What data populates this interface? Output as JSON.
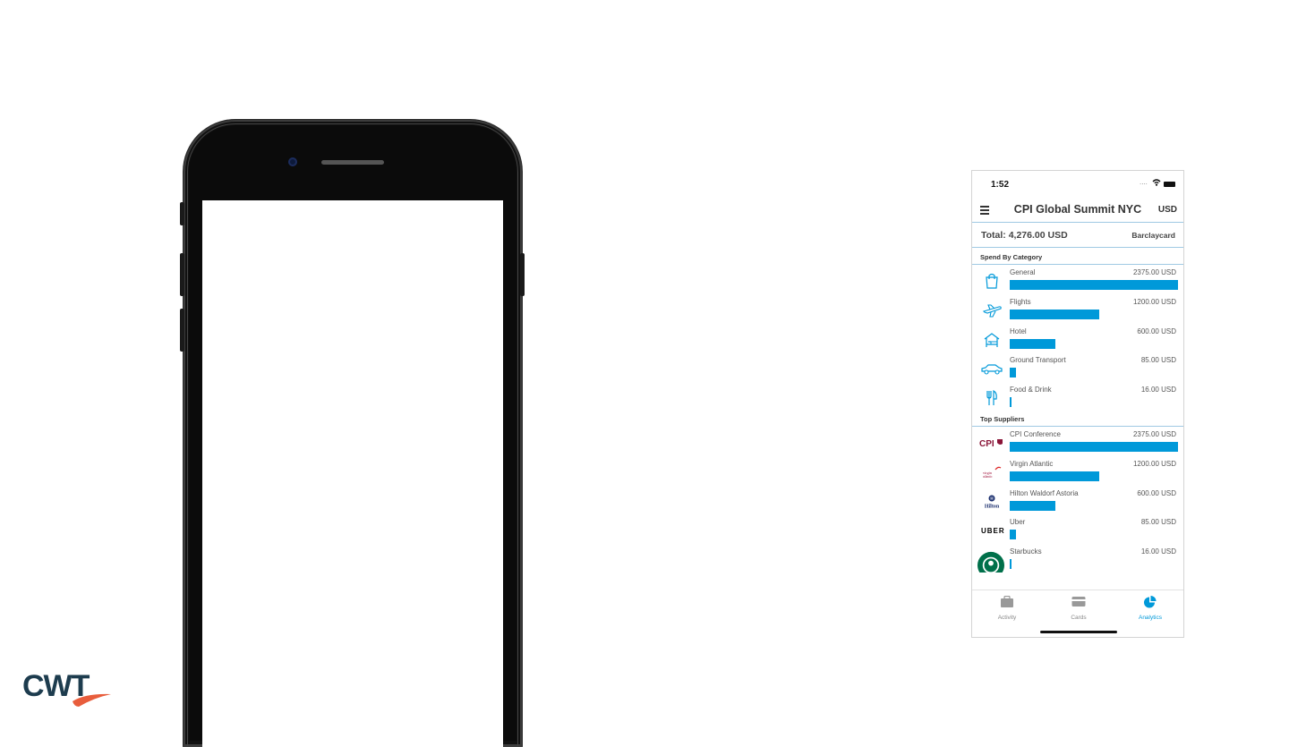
{
  "app": {
    "status": {
      "time": "1:52",
      "signal_dots": "...."
    },
    "nav": {
      "title": "CPI Global Summit NYC",
      "currency": "USD"
    },
    "summary": {
      "total": "Total: 4,276.00 USD",
      "card": "Barclaycard"
    },
    "spend_by_category": {
      "heading": "Spend By Category",
      "items": [
        {
          "label": "General",
          "amount": "2375.00 USD",
          "fraction": 1.0,
          "icon": "shopping-bag-icon"
        },
        {
          "label": "Flights",
          "amount": "1200.00 USD",
          "fraction": 0.53,
          "icon": "airplane-icon"
        },
        {
          "label": "Hotel",
          "amount": "600.00 USD",
          "fraction": 0.27,
          "icon": "hotel-bed-icon"
        },
        {
          "label": "Ground Transport",
          "amount": "85.00 USD",
          "fraction": 0.035,
          "icon": "car-icon"
        },
        {
          "label": "Food & Drink",
          "amount": "16.00 USD",
          "fraction": 0.007,
          "icon": "fork-knife-icon"
        }
      ]
    },
    "top_suppliers": {
      "heading": "Top Suppliers",
      "items": [
        {
          "label": "CPI Conference",
          "amount": "2375.00 USD",
          "fraction": 1.0,
          "logo_text": "CPI"
        },
        {
          "label": "Virgin Atlantic",
          "amount": "1200.00 USD",
          "fraction": 0.53,
          "logo_text": "virgin atlantic"
        },
        {
          "label": "Hilton Waldorf Astoria",
          "amount": "600.00 USD",
          "fraction": 0.27,
          "logo_text": "Hilton"
        },
        {
          "label": "Uber",
          "amount": "85.00 USD",
          "fraction": 0.035,
          "logo_text": "UBER"
        },
        {
          "label": "Starbucks",
          "amount": "16.00 USD",
          "fraction": 0.007,
          "logo_text": ""
        }
      ]
    },
    "tabs": [
      {
        "label": "Activity",
        "icon": "briefcase-icon",
        "active": false
      },
      {
        "label": "Cards",
        "icon": "credit-card-icon",
        "active": false
      },
      {
        "label": "Analytics",
        "icon": "pie-chart-icon",
        "active": true
      }
    ]
  },
  "brand": {
    "logo_text": "CWT",
    "accent": "#0099d9",
    "logo_color": "#1d3c4e",
    "logo_swoosh": "#e85d3c"
  }
}
